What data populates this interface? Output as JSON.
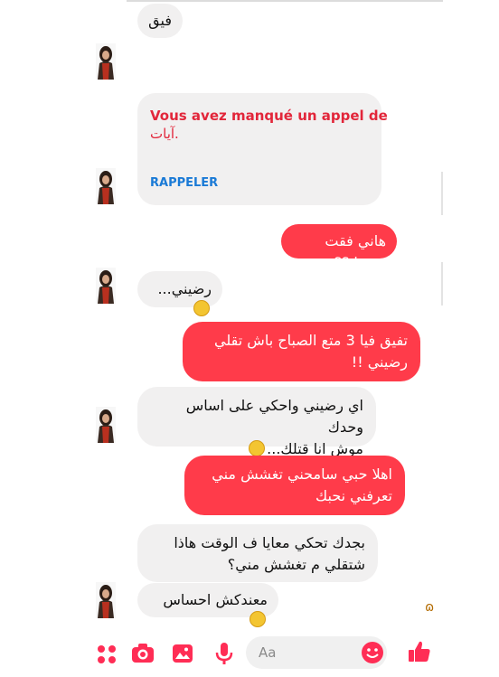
{
  "colors": {
    "outgoing": "#ff3b4a",
    "incoming": "#f1f0f0",
    "accent": "#ff2d55",
    "link": "#1a7ad6"
  },
  "messages": [
    {
      "side": "in",
      "text": "فيق"
    },
    {
      "side": "in",
      "text": "رضيني..."
    },
    {
      "side": "out",
      "text": "هاني فقت شفما ؟؟"
    },
    {
      "side": "out",
      "lines": [
        "تفيق فيا 3 متع الصباح باش تقلي",
        "رضيني !!"
      ]
    },
    {
      "side": "in",
      "lines": [
        "اي رضيني واحكي على اساس وحدك",
        "موش انا قتلك..."
      ]
    },
    {
      "side": "out",
      "lines": [
        "اهلا حبي سامحني تغشش مني",
        "تعرفني نحبك"
      ]
    },
    {
      "side": "in",
      "lines": [
        "بجدك تحكي معايا ف الوقت هاذا",
        "شتقلي م تغشش مني؟"
      ]
    },
    {
      "side": "in",
      "text": "معندكش احساس"
    }
  ],
  "missed_call": {
    "title": "Vous avez manqué un appel de",
    "name": ".آيات",
    "action": "RAPPELER"
  },
  "composer": {
    "placeholder": "Aa",
    "icons": [
      "apps-icon",
      "camera-icon",
      "gallery-icon",
      "microphone-icon",
      "emoji-icon",
      "like-icon"
    ]
  }
}
